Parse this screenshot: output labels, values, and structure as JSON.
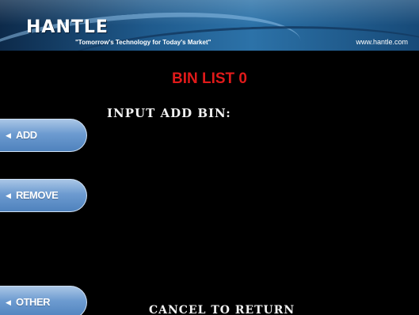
{
  "header": {
    "logo": "HANTLE",
    "tagline": "\"Tomorrow's Technology for Today's Market\"",
    "url": "www.hantle.com"
  },
  "screen": {
    "title": "BIN LIST 0",
    "prompt": "INPUT ADD BIN:",
    "footer": "CANCEL TO RETURN"
  },
  "buttons": {
    "left": [
      {
        "label": "ADD",
        "icon": "caret-left-icon"
      },
      {
        "label": "REMOVE",
        "icon": "caret-left-icon"
      },
      {
        "label": "OTHER",
        "icon": "caret-left-icon"
      }
    ]
  },
  "colors": {
    "background": "#000000",
    "title": "#e01a1a",
    "text": "#f2f2f2",
    "button": "#6d9bd0",
    "header": "#1f5a8c"
  }
}
